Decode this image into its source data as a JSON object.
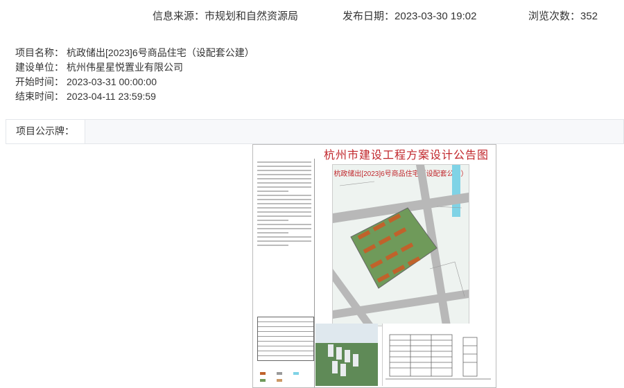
{
  "header": {
    "source_label": "信息来源：",
    "source_value": "市规划和自然资源局",
    "date_label": "发布日期：",
    "date_value": "2023-03-30 19:02",
    "views_label": "浏览次数：",
    "views_value": "352"
  },
  "info": [
    {
      "label": "项目名称：",
      "value": "杭政储出[2023]6号商品住宅（设配套公建）"
    },
    {
      "label": "建设单位：",
      "value": "杭州伟星星悦置业有限公司"
    },
    {
      "label": "开始时间：",
      "value": "2023-03-31 00:00:00"
    },
    {
      "label": "结束时间：",
      "value": "2023-04-11 23:59:59"
    }
  ],
  "tab": {
    "label": "项目公示牌："
  },
  "poster": {
    "title": "杭州市建设工程方案设计公告图",
    "plan_title": "杭政储出[2023]6号商品住宅（设配套公建）"
  },
  "colors": {
    "building_roof": "#c0622b",
    "green_space": "#6f9a5a",
    "road": "#9a9a9a",
    "water": "#7fd3e6",
    "title_red": "#c0252a"
  }
}
